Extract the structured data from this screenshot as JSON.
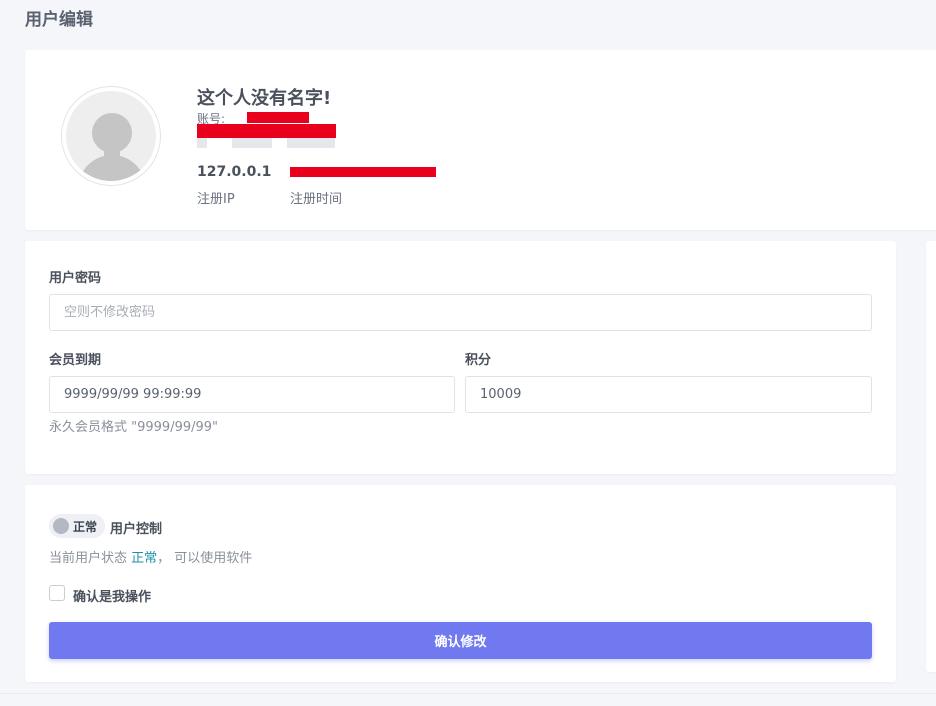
{
  "page": {
    "title": "用户编辑"
  },
  "profile": {
    "name": "这个人没有名字!",
    "account_label": "账号:",
    "ip_value": "127.0.0.1",
    "ip_label": "注册IP",
    "time_label": "注册时间"
  },
  "form": {
    "password_label": "用户密码",
    "password_placeholder": "空则不修改密码",
    "expiry_label": "会员到期",
    "expiry_value": "9999/99/99 99:99:99",
    "points_label": "积分",
    "points_value": "10009",
    "hint": "永久会员格式 \"9999/99/99\""
  },
  "control": {
    "switch_text": "正常",
    "switch_label": "用户控制",
    "status_prefix": "当前用户状态 ",
    "status_word": "正常",
    "status_suffix": "， 可以使用软件",
    "confirm_label": "确认是我操作",
    "submit_label": "确认修改"
  },
  "colors": {
    "accent": "#7079f0",
    "status": "#1f8fa8",
    "redaction": "#e8001c"
  },
  "icons": {
    "avatar": "default-user-avatar-icon"
  }
}
